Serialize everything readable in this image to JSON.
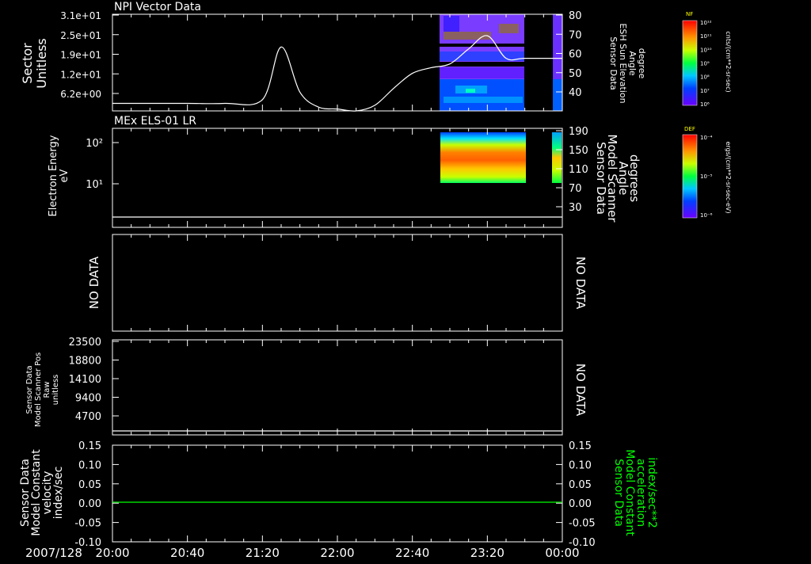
{
  "colors": {
    "background": "#000000",
    "axes": "#ffffff",
    "trace": "#ffffff",
    "green_trace": "#00ff00"
  },
  "panels": [
    {
      "title": "NPI Vector Data",
      "ylabel": [
        "Sector",
        "Unitless"
      ],
      "yticks": [
        "3.1e+01",
        "2.5e+01",
        "1.9e+01",
        "1.2e+01",
        "6.2e+00"
      ],
      "right_ylabel": [
        "Sensor Data",
        "ESH Sun Elevation",
        "Angle",
        "degree"
      ],
      "right_yticks": [
        "80",
        "70",
        "60",
        "50",
        "40"
      ]
    },
    {
      "title": "MEx ELS-01 LR",
      "ylabel": [
        "Electron Energy",
        "eV"
      ],
      "yticks": [
        "10²",
        "10¹"
      ],
      "right_ylabel": [
        "Sensor Data",
        "Model Scanner",
        "Angle",
        "degrees"
      ],
      "right_yticks": [
        "190",
        "150",
        "110",
        "70",
        "30"
      ]
    },
    {
      "left_label": "NO DATA",
      "right_label": "NO DATA"
    },
    {
      "ylabel": [
        "Sensor Data",
        "Model Scanner Pos",
        "Raw",
        "unitless"
      ],
      "yticks": [
        "23500",
        "18800",
        "14100",
        "9400",
        "4700"
      ],
      "right_label": "NO DATA"
    },
    {
      "ylabel": [
        "Sensor Data",
        "Model Constant",
        "velocity",
        "index/sec"
      ],
      "yticks": [
        "0.15",
        "0.10",
        "0.05",
        "0.00",
        "-0.05",
        "-0.10"
      ],
      "right_ylabel": [
        "Sensor Data",
        "Model Constant",
        "acceleration",
        "index/sec**2"
      ],
      "right_yticks": [
        "0.15",
        "0.10",
        "0.05",
        "0.00",
        "-0.05",
        "-0.10"
      ]
    }
  ],
  "xaxis": {
    "date": "2007/128",
    "ticks": [
      "20:00",
      "20:40",
      "21:20",
      "22:00",
      "22:40",
      "23:20",
      "00:00"
    ]
  },
  "colorbars": [
    {
      "label": "NF",
      "unit": "cnts/(cm**2-sr-sec)",
      "ticks": [
        "10¹²",
        "10¹¹",
        "10¹⁰",
        "10⁹",
        "10⁸",
        "10⁷",
        "10⁶"
      ]
    },
    {
      "label": "DEF",
      "unit": "ergs/(cm**2-sr-sec-eV)",
      "ticks": [
        "10⁻⁴",
        "10⁻⁵",
        "10⁻⁶"
      ]
    }
  ],
  "chart_data": [
    {
      "type": "line",
      "name": "ESH Sun Elevation Angle",
      "x": [
        "20:00",
        "20:20",
        "20:40",
        "21:00",
        "21:20",
        "21:30",
        "21:40",
        "21:50",
        "22:00",
        "22:10",
        "22:20",
        "22:30",
        "22:40",
        "22:50",
        "23:00",
        "23:10",
        "23:20",
        "23:30",
        "23:40",
        "00:00"
      ],
      "y": [
        34,
        34,
        34,
        34,
        36,
        64,
        40,
        32,
        31,
        30,
        33,
        42,
        50,
        53,
        55,
        63,
        70,
        58,
        58,
        58
      ],
      "right_ylim": [
        30,
        80
      ]
    },
    {
      "type": "heatmap",
      "name": "Electron Energy spectrogram",
      "data_intervals": [
        [
          "22:50",
          "23:40"
        ],
        [
          "23:55",
          "00:00"
        ]
      ],
      "ylog": true
    },
    {
      "type": "line",
      "name": "Model Scanner Angle",
      "x": [
        "20:00",
        "00:00"
      ],
      "y": [
        18,
        18
      ],
      "right_ylim": [
        10,
        190
      ]
    },
    {
      "type": "line",
      "name": "Model Scanner Pos Raw",
      "x": [
        "20:00",
        "00:00"
      ],
      "y": [
        0,
        0
      ],
      "ylim": [
        0,
        23500
      ]
    },
    {
      "type": "line",
      "name": "Model Constant velocity",
      "x": [
        "20:00",
        "00:00"
      ],
      "y": [
        0,
        0
      ],
      "ylim": [
        -0.1,
        0.15
      ]
    }
  ]
}
